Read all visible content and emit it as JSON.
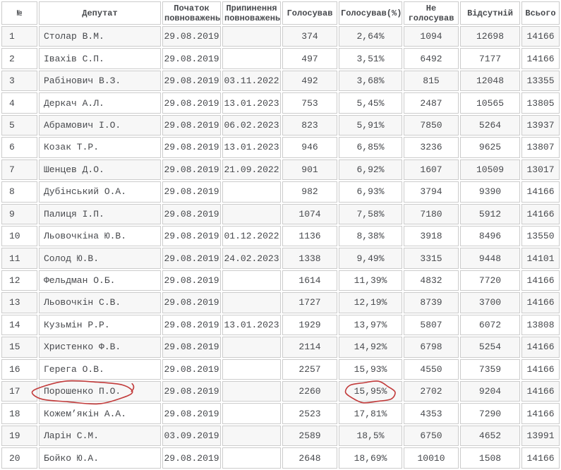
{
  "table": {
    "columns": [
      {
        "key": "num",
        "label": "№",
        "align": "left"
      },
      {
        "key": "deputy",
        "label": "Депутат",
        "align": "left"
      },
      {
        "key": "start",
        "label": "Початок повноважень",
        "align": "center"
      },
      {
        "key": "end",
        "label": "Припинення повноважень",
        "align": "center"
      },
      {
        "key": "voted",
        "label": "Голосував",
        "align": "center"
      },
      {
        "key": "voted_pct",
        "label": "Голосував(%)",
        "align": "center"
      },
      {
        "key": "not_voted",
        "label": "Не голосував",
        "align": "center"
      },
      {
        "key": "absent",
        "label": "Відсутній",
        "align": "center"
      },
      {
        "key": "total",
        "label": "Всього",
        "align": "center"
      }
    ],
    "rows": [
      {
        "num": "1",
        "deputy": "Столар В.М.",
        "start": "29.08.2019",
        "end": "",
        "voted": "374",
        "voted_pct": "2,64%",
        "not_voted": "1094",
        "absent": "12698",
        "total": "14166"
      },
      {
        "num": "2",
        "deputy": "Івахів С.П.",
        "start": "29.08.2019",
        "end": "",
        "voted": "497",
        "voted_pct": "3,51%",
        "not_voted": "6492",
        "absent": "7177",
        "total": "14166"
      },
      {
        "num": "3",
        "deputy": "Рабінович В.З.",
        "start": "29.08.2019",
        "end": "03.11.2022",
        "voted": "492",
        "voted_pct": "3,68%",
        "not_voted": "815",
        "absent": "12048",
        "total": "13355"
      },
      {
        "num": "4",
        "deputy": "Деркач А.Л.",
        "start": "29.08.2019",
        "end": "13.01.2023",
        "voted": "753",
        "voted_pct": "5,45%",
        "not_voted": "2487",
        "absent": "10565",
        "total": "13805"
      },
      {
        "num": "5",
        "deputy": "Абрамович І.О.",
        "start": "29.08.2019",
        "end": "06.02.2023",
        "voted": "823",
        "voted_pct": "5,91%",
        "not_voted": "7850",
        "absent": "5264",
        "total": "13937"
      },
      {
        "num": "6",
        "deputy": "Козак Т.Р.",
        "start": "29.08.2019",
        "end": "13.01.2023",
        "voted": "946",
        "voted_pct": "6,85%",
        "not_voted": "3236",
        "absent": "9625",
        "total": "13807"
      },
      {
        "num": "7",
        "deputy": "Шенцев Д.О.",
        "start": "29.08.2019",
        "end": "21.09.2022",
        "voted": "901",
        "voted_pct": "6,92%",
        "not_voted": "1607",
        "absent": "10509",
        "total": "13017"
      },
      {
        "num": "8",
        "deputy": "Дубінський О.А.",
        "start": "29.08.2019",
        "end": "",
        "voted": "982",
        "voted_pct": "6,93%",
        "not_voted": "3794",
        "absent": "9390",
        "total": "14166"
      },
      {
        "num": "9",
        "deputy": "Палиця І.П.",
        "start": "29.08.2019",
        "end": "",
        "voted": "1074",
        "voted_pct": "7,58%",
        "not_voted": "7180",
        "absent": "5912",
        "total": "14166"
      },
      {
        "num": "10",
        "deputy": "Льовочкіна Ю.В.",
        "start": "29.08.2019",
        "end": "01.12.2022",
        "voted": "1136",
        "voted_pct": "8,38%",
        "not_voted": "3918",
        "absent": "8496",
        "total": "13550"
      },
      {
        "num": "11",
        "deputy": "Солод Ю.В.",
        "start": "29.08.2019",
        "end": "24.02.2023",
        "voted": "1338",
        "voted_pct": "9,49%",
        "not_voted": "3315",
        "absent": "9448",
        "total": "14101"
      },
      {
        "num": "12",
        "deputy": "Фельдман О.Б.",
        "start": "29.08.2019",
        "end": "",
        "voted": "1614",
        "voted_pct": "11,39%",
        "not_voted": "4832",
        "absent": "7720",
        "total": "14166"
      },
      {
        "num": "13",
        "deputy": "Льовочкін С.В.",
        "start": "29.08.2019",
        "end": "",
        "voted": "1727",
        "voted_pct": "12,19%",
        "not_voted": "8739",
        "absent": "3700",
        "total": "14166"
      },
      {
        "num": "14",
        "deputy": "Кузьмін Р.Р.",
        "start": "29.08.2019",
        "end": "13.01.2023",
        "voted": "1929",
        "voted_pct": "13,97%",
        "not_voted": "5807",
        "absent": "6072",
        "total": "13808"
      },
      {
        "num": "15",
        "deputy": "Христенко Ф.В.",
        "start": "29.08.2019",
        "end": "",
        "voted": "2114",
        "voted_pct": "14,92%",
        "not_voted": "6798",
        "absent": "5254",
        "total": "14166"
      },
      {
        "num": "16",
        "deputy": "Герега О.В.",
        "start": "29.08.2019",
        "end": "",
        "voted": "2257",
        "voted_pct": "15,93%",
        "not_voted": "4550",
        "absent": "7359",
        "total": "14166"
      },
      {
        "num": "17",
        "deputy": "Порошенко П.О.",
        "start": "29.08.2019",
        "end": "",
        "voted": "2260",
        "voted_pct": "15,95%",
        "not_voted": "2702",
        "absent": "9204",
        "total": "14166"
      },
      {
        "num": "18",
        "deputy": "Кожем’якін А.А.",
        "start": "29.08.2019",
        "end": "",
        "voted": "2523",
        "voted_pct": "17,81%",
        "not_voted": "4353",
        "absent": "7290",
        "total": "14166"
      },
      {
        "num": "19",
        "deputy": "Ларін С.М.",
        "start": "03.09.2019",
        "end": "",
        "voted": "2589",
        "voted_pct": "18,5%",
        "not_voted": "6750",
        "absent": "4652",
        "total": "13991"
      },
      {
        "num": "20",
        "deputy": "Бойко Ю.А.",
        "start": "29.08.2019",
        "end": "",
        "voted": "2648",
        "voted_pct": "18,69%",
        "not_voted": "10010",
        "absent": "1508",
        "total": "14166"
      }
    ]
  },
  "annotations": {
    "circled_row_number": "17",
    "circled_deputy": "Порошенко П.О.",
    "circled_value": "15,95%",
    "color": "#c23b3b"
  },
  "colors": {
    "text": "#47494d",
    "border": "#cccccc",
    "row_stripe": "#f7f7f7",
    "annotation": "#c23b3b"
  }
}
